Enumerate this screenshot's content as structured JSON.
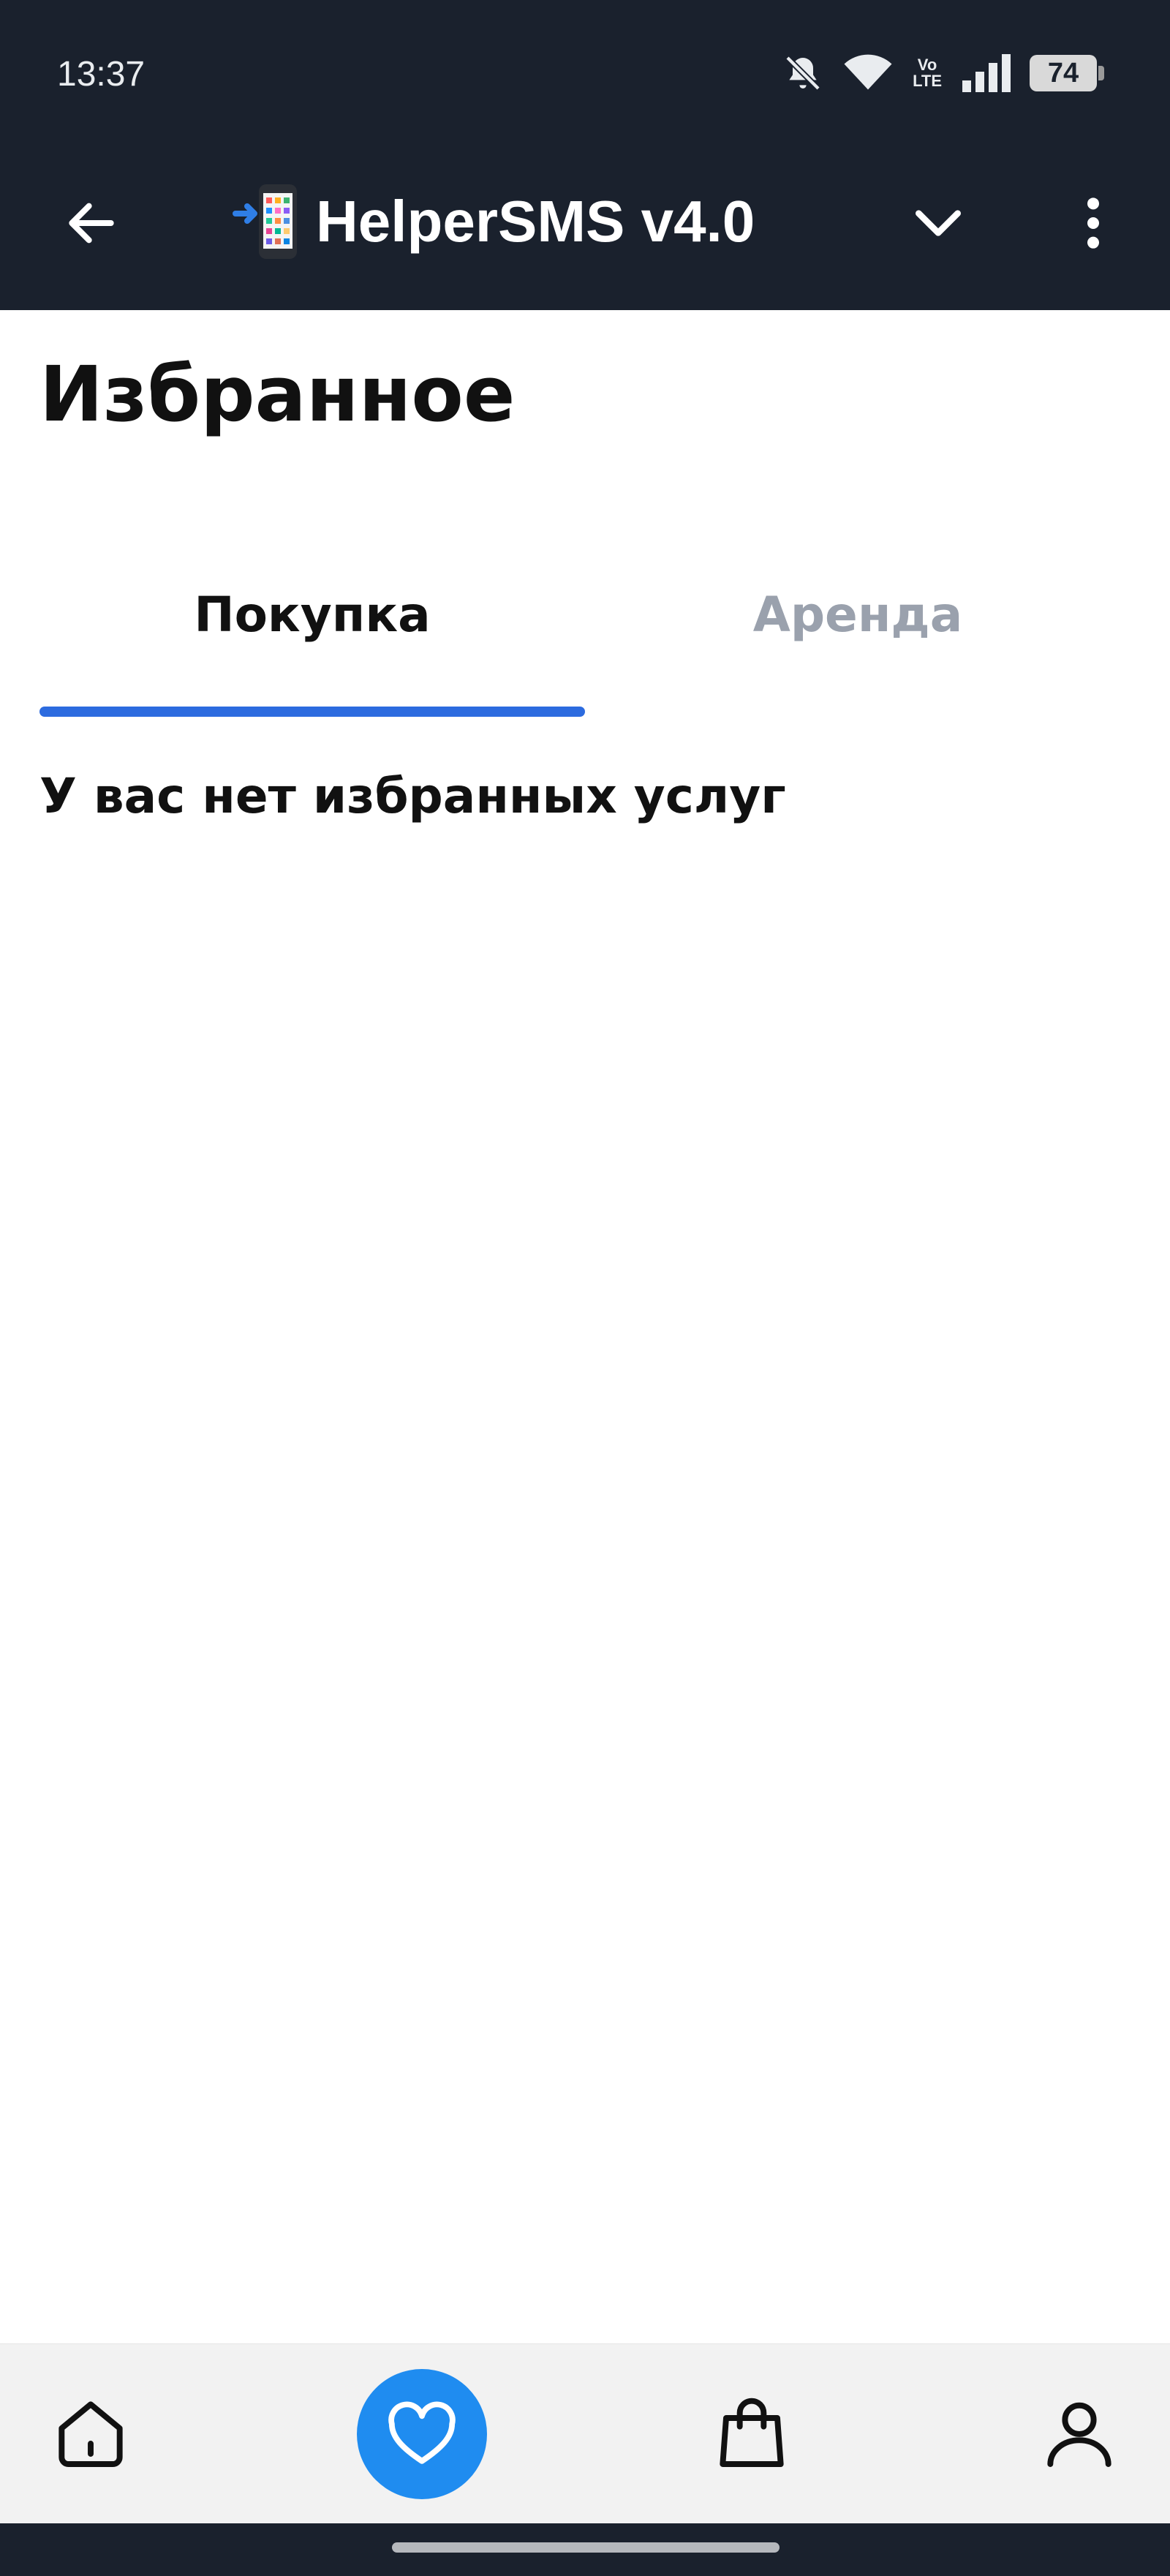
{
  "status_bar": {
    "time": "13:37",
    "network_badge_top": "Vo",
    "network_badge_bottom": "LTE",
    "battery_level": "74",
    "icons": [
      "bell-muted-icon",
      "wifi-icon",
      "volte-icon",
      "signal-icon",
      "battery-icon"
    ]
  },
  "app_bar": {
    "title": "HelperSMS v4.0",
    "icons": [
      "back-arrow-icon",
      "phone-arrow-emoji-icon",
      "chevron-down-icon",
      "more-vertical-icon"
    ]
  },
  "page": {
    "title": "Избранное",
    "empty_message": "У вас нет избранных услуг"
  },
  "tabs": [
    {
      "label": "Покупка",
      "active": true
    },
    {
      "label": "Аренда",
      "active": false
    }
  ],
  "bottom_nav": {
    "items": [
      {
        "icon": "home-icon",
        "active": false
      },
      {
        "icon": "heart-icon",
        "active": true
      },
      {
        "icon": "shopping-bag-icon",
        "active": false
      },
      {
        "icon": "user-icon",
        "active": false
      }
    ]
  },
  "colors": {
    "bar_background": "#1a212d",
    "accent": "#2c6bdf",
    "active_nav": "#1f8cf0",
    "inactive_tab": "#9aa1ad"
  }
}
